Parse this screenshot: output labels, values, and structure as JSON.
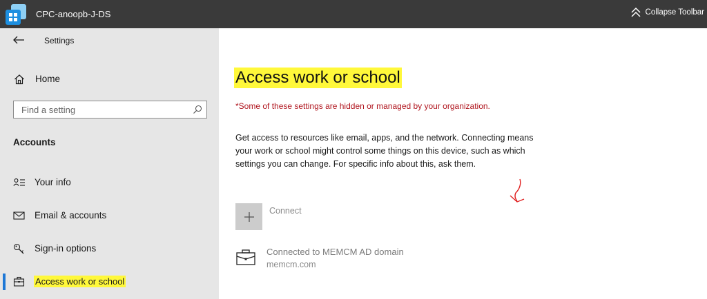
{
  "toolbar": {
    "title": "CPC-anoopb-J-DS",
    "collapse_label": "Collapse Toolbar"
  },
  "sidebar": {
    "header_title": "Settings",
    "home_label": "Home",
    "search_placeholder": "Find a setting",
    "section_title": "Accounts",
    "items": [
      {
        "label": "Your info",
        "icon": "person-icon"
      },
      {
        "label": "Email & accounts",
        "icon": "mail-icon"
      },
      {
        "label": "Sign-in options",
        "icon": "key-icon"
      },
      {
        "label": "Access work or school",
        "icon": "briefcase-icon",
        "active": true
      }
    ]
  },
  "main": {
    "title": "Access work or school",
    "managed_note": "*Some of these settings are hidden or managed by your organization.",
    "description": "Get access to resources like email, apps, and the network. Connecting means your work or school might control some things on this device, such as which settings you can change. For specific info about this, ask them.",
    "connect_label": "Connect",
    "connection": {
      "name": "Connected to MEMCM AD domain",
      "domain": "memcm.com"
    }
  },
  "colors": {
    "highlight": "#fff83a",
    "accent": "#1e78d6",
    "warning_text": "#b0151e",
    "toolbar_bg": "#3a3a3a",
    "sidebar_bg": "#e6e6e6"
  }
}
